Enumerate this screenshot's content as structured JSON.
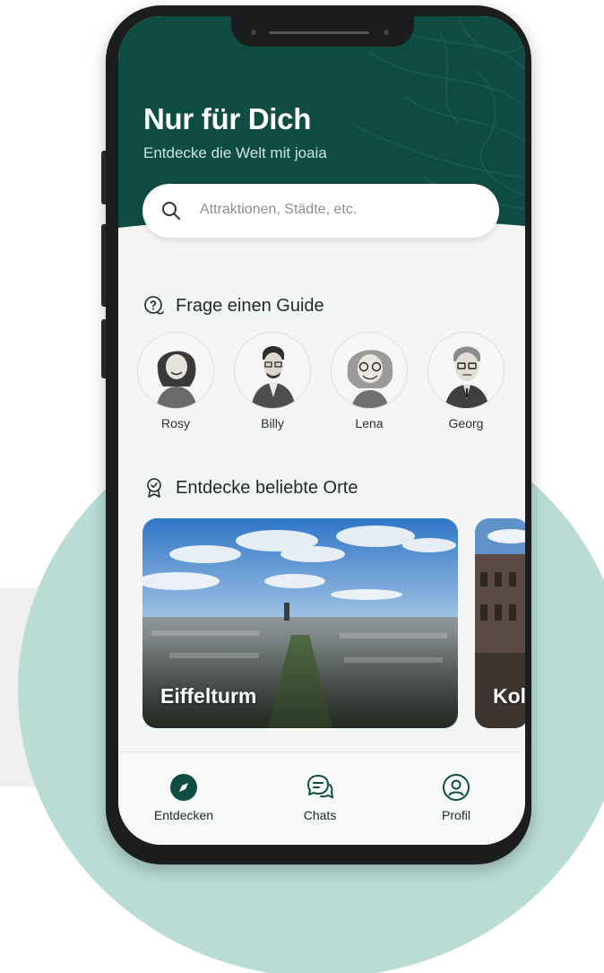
{
  "header": {
    "title": "Nur für Dich",
    "subtitle": "Entdecke die Welt mit joaia",
    "background_color": "#0f4c44"
  },
  "search": {
    "placeholder": "Attraktionen, Städte, etc.",
    "icon": "search-icon"
  },
  "guides_section": {
    "title": "Frage einen Guide",
    "icon": "question-chat-icon",
    "guides": [
      {
        "name": "Rosy"
      },
      {
        "name": "Billy"
      },
      {
        "name": "Lena"
      },
      {
        "name": "Georg"
      }
    ]
  },
  "places_section": {
    "title": "Entdecke beliebte Orte",
    "icon": "award-badge-icon",
    "places": [
      {
        "label": "Eiffelturm"
      },
      {
        "label": "Kol"
      }
    ]
  },
  "navbar": {
    "items": [
      {
        "label": "Entdecken",
        "icon": "compass-icon",
        "active": true
      },
      {
        "label": "Chats",
        "icon": "chat-bubbles-icon",
        "active": false
      },
      {
        "label": "Profil",
        "icon": "profile-icon",
        "active": false
      }
    ]
  },
  "colors": {
    "primary": "#0f4c44",
    "accent_circle": "#b9ddd5",
    "text_dark": "#1f2a28"
  }
}
